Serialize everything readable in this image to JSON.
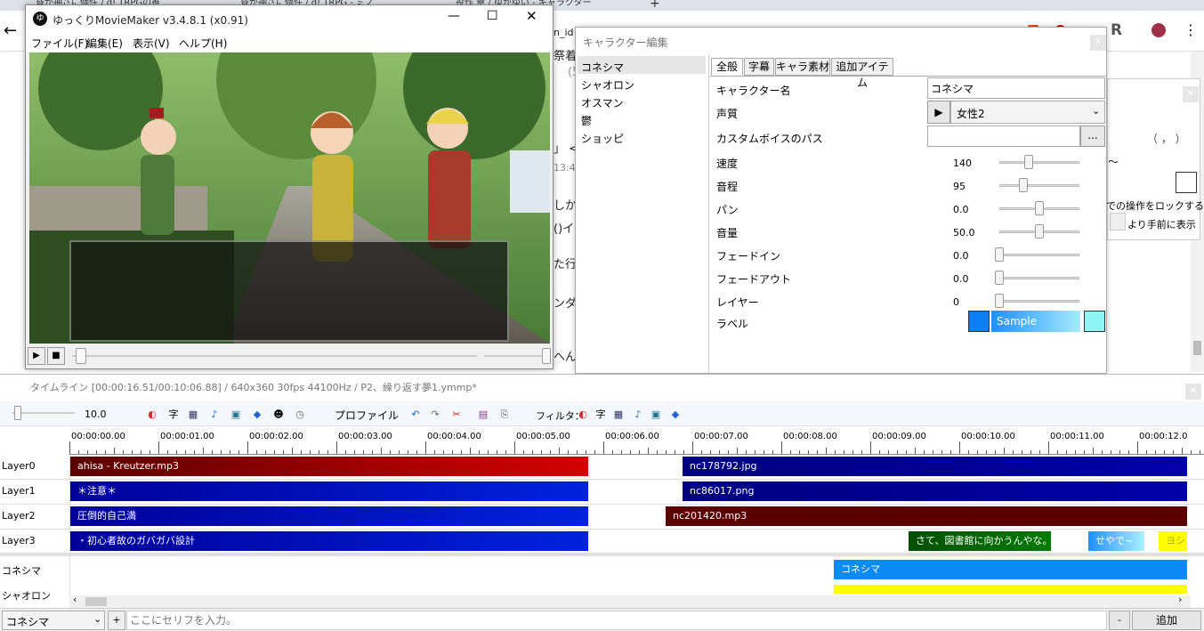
{
  "browser": {
    "tabs": [
      "昏が抽さに個件 / d! TRPGの推",
      "昏が抽さに個件 / d! TRPG - ミノ",
      "投作 章 / ゆかゆい - キャラクター"
    ],
    "content_fragments": [
      "n_id",
      "祭着",
      "(5",
      "」 <",
      "13:4",
      "しか",
      "()イ",
      "た行",
      "ンダ",
      "へん"
    ]
  },
  "ymm": {
    "title": "ゆっくりMovieMaker v3.4.8.1 (x0.91)",
    "menu": [
      "ファイル(F)",
      "編集(E)",
      "表示(V)",
      "ヘルプ(H)"
    ]
  },
  "char_editor": {
    "title": "キャラクター編集",
    "characters": [
      "コネシマ",
      "シャオロン",
      "オスマン",
      "鬱",
      "ショッピ"
    ],
    "tabs": [
      "全般",
      "字幕",
      "キャラ素材",
      "追加アイテム"
    ],
    "name_label": "キャラクター名",
    "name_value": "コネシマ",
    "voice_label": "声質",
    "voice_value": "女性2",
    "custom_voice_label": "カスタムボイスのパス",
    "browse_label": "...",
    "params": [
      {
        "label": "速度",
        "value": "140",
        "level": 0.37
      },
      {
        "label": "音程",
        "value": "95",
        "level": 0.3
      },
      {
        "label": "パン",
        "value": "0.0",
        "level": 0.5
      },
      {
        "label": "音量",
        "value": "50.0",
        "level": 0.5
      },
      {
        "label": "フェードイン",
        "value": "0.0",
        "level": 0
      },
      {
        "label": "フェードアウト",
        "value": "0.0",
        "level": 0
      },
      {
        "label": "レイヤー",
        "value": "0",
        "level": 0
      }
    ],
    "label_label": "ラベル",
    "sample_text": "Sample"
  },
  "right_dialog": {
    "lock_text": "での操作をロックする",
    "front_text": "より手前に表示",
    "paren_text": "（   ，   ）"
  },
  "timeline": {
    "title": "タイムライン [00:00:16.51/00:10:06.88] / 640x360 30fps 44100Hz / P2、繰り返す夢1.ymmp*",
    "zoom_value": "10.0",
    "profile_label": "プロファイル",
    "filter_label": "フィルタ：",
    "ruler_ticks": [
      "00:00:00.00",
      "00:00:01.00",
      "00:00:02.00",
      "00:00:03.00",
      "00:00:04.00",
      "00:00:05.00",
      "00:00:06.00",
      "00:00:07.00",
      "00:00:08.00",
      "00:00:09.00",
      "00:00:10.00",
      "00:00:11.00",
      "00:00:12.0"
    ],
    "layers": [
      "Layer0",
      "Layer1",
      "Layer2",
      "Layer3"
    ],
    "clips": [
      {
        "layer": 0,
        "text": "ahisa - Kreutzer.mp3",
        "kind": "audio"
      },
      {
        "layer": 0,
        "text": "nc178792.jpg",
        "kind": "image"
      },
      {
        "layer": 1,
        "text": "＊注意＊",
        "kind": "text"
      },
      {
        "layer": 1,
        "text": "nc86017.png",
        "kind": "image"
      },
      {
        "layer": 2,
        "text": "圧倒的自己満",
        "kind": "text"
      },
      {
        "layer": 2,
        "text": "nc201420.mp3",
        "kind": "audio"
      },
      {
        "layer": 3,
        "text": "・初心者故のガバガバ設計",
        "kind": "text"
      },
      {
        "layer": 3,
        "text": "さて、図書館に向かうんやな。",
        "kind": "voice"
      },
      {
        "layer": 3,
        "text": "せやで~",
        "kind": "voice2"
      },
      {
        "layer": 3,
        "text": "ヨシ",
        "kind": "voice3"
      }
    ],
    "char_tracks": [
      "コネシマ",
      "シャオロン"
    ],
    "char_clip": "コネシマ",
    "bottom": {
      "character_select": "コネシマ",
      "plus": "+",
      "placeholder": "ここにセリフを入力。",
      "minus": "-",
      "add_label": "追加"
    }
  }
}
